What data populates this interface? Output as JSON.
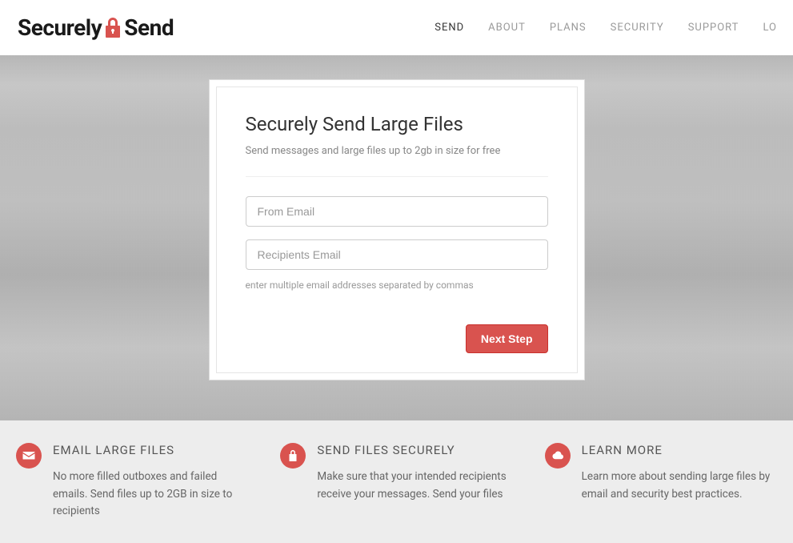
{
  "logo": {
    "part1": "Securely",
    "part2": "Send"
  },
  "nav": {
    "items": [
      {
        "label": "SEND",
        "active": true
      },
      {
        "label": "ABOUT",
        "active": false
      },
      {
        "label": "PLANS",
        "active": false
      },
      {
        "label": "SECURITY",
        "active": false
      },
      {
        "label": "SUPPORT",
        "active": false
      },
      {
        "label": "LO",
        "active": false
      }
    ]
  },
  "card": {
    "title": "Securely Send Large Files",
    "subtitle": "Send messages and large files up to 2gb in size for free",
    "from_placeholder": "From Email",
    "recipients_placeholder": "Recipients Email",
    "help_text": "enter multiple email addresses separated by commas",
    "next_label": "Next Step"
  },
  "features": [
    {
      "icon": "envelope-icon",
      "title": "EMAIL LARGE FILES",
      "body": "No more filled outboxes and failed emails. Send files up to 2GB in size to recipients"
    },
    {
      "icon": "lock-icon",
      "title": "SEND FILES SECURELY",
      "body": "Make sure that your intended recipients receive your messages. Send your files"
    },
    {
      "icon": "cloud-icon",
      "title": "LEARN MORE",
      "body": "Learn more about sending large files by email and security best practices."
    }
  ]
}
